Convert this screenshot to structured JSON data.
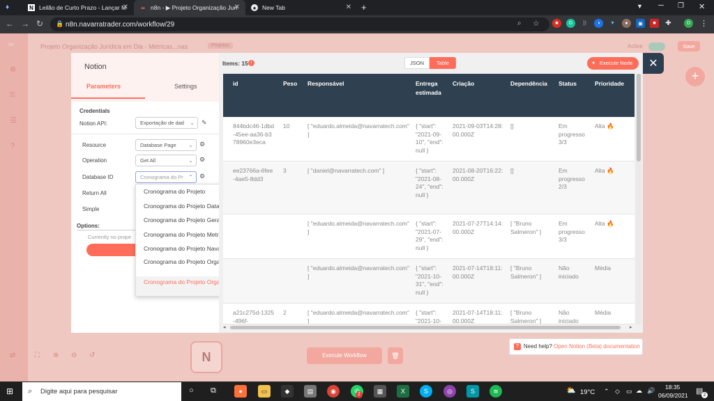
{
  "browser": {
    "tabs": [
      {
        "title": "Leilão de Curto Prazo - Lançar M",
        "icon": "notion-icon"
      },
      {
        "title": "n8n - ▶ Projeto Organização Jurí",
        "icon": "n8n-icon"
      },
      {
        "title": "New Tab",
        "icon": "chrome-icon"
      }
    ],
    "url": "n8n.navarratrader.com/workflow/29",
    "profile_initial": "D"
  },
  "app": {
    "workflow_title": "Projeto Organização Jurídica em Dia - Métricas...nas",
    "tag": "Projetos",
    "active_label": "Active",
    "save_label": "Save",
    "execute_workflow": "Execute Workflow"
  },
  "node_panel": {
    "title": "Notion",
    "tabs": {
      "parameters": "Parameters",
      "settings": "Settings"
    },
    "credentials_heading": "Credentials",
    "notion_api_label": "Notion API:",
    "notion_api_value": "Exportação de dad",
    "resource_label": "Resource",
    "resource_value": "Database Page",
    "operation_label": "Operation",
    "operation_value": "Get All",
    "database_id_label": "Database ID",
    "database_id_placeholder": "Cronograma do Pr",
    "return_all_label": "Return All",
    "simple_label": "Simple",
    "options_label": "Options:",
    "no_properties": "Currently no prope"
  },
  "dropdown": {
    "options": [
      "Cronograma do Projeto",
      "Cronograma do Projeto Data Room",
      "Cronograma do Projeto Geração Informacional",
      "Cronograma do Projeto Metrificação",
      "Cronograma do Projeto Navarra Trader",
      "Cronograma do Projeto Organização Contábil em dia",
      "Cronograma do Projeto Organização Jurídica em Dia"
    ],
    "selected_index": 6
  },
  "output": {
    "items_label": "Items: 15",
    "view_json": "JSON",
    "view_table": "Table",
    "execute_node": "Execute Node",
    "columns": [
      "id",
      "Peso",
      "Responsável",
      "Entrega estimada",
      "Criação",
      "Dependência",
      "Status",
      "Prioridade"
    ],
    "rows": [
      {
        "id": "844bdc46-1dbd-45ee-aa36-b378960e3eca",
        "peso": "10",
        "responsavel": "[ \"eduardo.almeida@navarratech.com\" ]",
        "entrega": "{ \"start\": \"2021-09-10\", \"end\": null }",
        "criacao": "2021-09-03T14:28:00.000Z",
        "dependencia": "[]",
        "status": "Em progresso 3/3",
        "prioridade": "Alta 🔥"
      },
      {
        "id": "ee23766a-6fee-4ae5-8dd3",
        "peso": "3",
        "responsavel": "[ \"daniel@navarratech.com\" ]",
        "entrega": "{ \"start\": \"2021-08-24\", \"end\": null }",
        "criacao": "2021-08-20T16:22:00.000Z",
        "dependencia": "[]",
        "status": "Em progresso 2/3",
        "prioridade": "Alta 🔥"
      },
      {
        "id": "",
        "peso": "",
        "responsavel": "[ \"eduardo.almeida@navarratech.com\" ]",
        "entrega": "{ \"start\": \"2021-07-29\", \"end\": null }",
        "criacao": "2021-07-27T14:14:00.000Z",
        "dependencia": "[ \"Bruno Salmeron\" ]",
        "status": "Em progresso 3/3",
        "prioridade": "Alta 🔥"
      },
      {
        "id": "",
        "peso": "",
        "responsavel": "[ \"eduardo.almeida@navarratech.com\" ]",
        "entrega": "{ \"start\": \"2021-10-31\", \"end\": null }",
        "criacao": "2021-07-14T18:11:00.000Z",
        "dependencia": "[ \"Bruno Salmeron\" ]",
        "status": "Não iniciado",
        "prioridade": "Média"
      },
      {
        "id": "a21c275d-1325-496f-",
        "peso": "2",
        "responsavel": "[ \"eduardo.almeida@navarratech.com\" ]",
        "entrega": "{ \"start\": \"2021-10-",
        "criacao": "2021-07-14T18:11:00.000Z",
        "dependencia": "[ \"Bruno Salmeron\" ]",
        "status": "Não iniciado",
        "prioridade": "Média"
      }
    ]
  },
  "help": {
    "prefix": "Need help?",
    "link": "Open Notion (Beta) documentation"
  },
  "taskbar": {
    "search_placeholder": "Digite aqui para pesquisar",
    "weather": "19°C",
    "time": "18:35",
    "date": "06/09/2021",
    "badge": "2",
    "notif": "2"
  },
  "colors": {
    "accent": "#ff6d5a",
    "table_header": "#2f4050",
    "chrome_dark": "#202124"
  }
}
